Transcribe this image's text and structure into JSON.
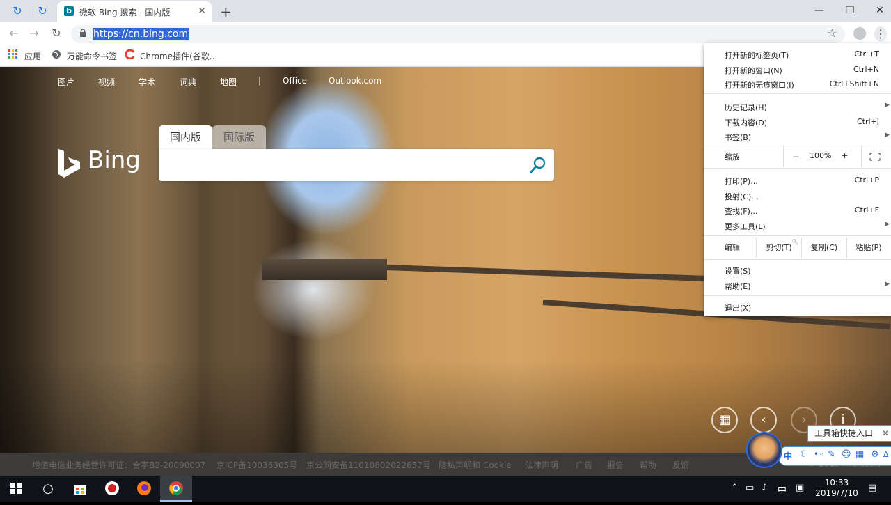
{
  "browser": {
    "tab": {
      "favicon": "b",
      "title": "微软 Bing 搜索 - 国内版",
      "close": "✕"
    },
    "new_tab": "+",
    "window": {
      "minimize": "—",
      "maximize": "❐",
      "close": "✕"
    },
    "address": {
      "url": "https://cn.bing.com"
    },
    "bookmarks": [
      {
        "label": "应用",
        "icon": "apps-grid-icon"
      },
      {
        "label": "万能命令书签",
        "icon": "globe-icon"
      },
      {
        "label": "Chrome插件(谷歌...",
        "icon": "chrome-c-icon"
      }
    ]
  },
  "page": {
    "nav_links": [
      "图片",
      "视频",
      "学术",
      "词典",
      "地图",
      "|",
      "Office",
      "Outlook.com"
    ],
    "logo_text": "Bing",
    "scope_tabs": [
      "国内版",
      "国际版"
    ],
    "footer_links": [
      "增值电信业务经营许可证：合字B2-20090007",
      "京ICP备10036305号",
      "京公网安备11010802022657号",
      "隐私声明和 Cookie",
      "法律声明",
      "广告",
      "报告",
      "帮助",
      "反馈",
      "© 2019 Microsoft"
    ]
  },
  "chrome_menu": {
    "new_tab": {
      "label": "打开新的标签页(T)",
      "shortcut": "Ctrl+T"
    },
    "new_window": {
      "label": "打开新的窗口(N)",
      "shortcut": "Ctrl+N"
    },
    "incognito": {
      "label": "打开新的无痕窗口(I)",
      "shortcut": "Ctrl+Shift+N"
    },
    "history": {
      "label": "历史记录(H)"
    },
    "downloads": {
      "label": "下载内容(D)",
      "shortcut": "Ctrl+J"
    },
    "bookmarks": {
      "label": "书签(B)"
    },
    "zoom": {
      "label": "缩放",
      "minus": "－",
      "value": "100%",
      "plus": "+"
    },
    "print": {
      "label": "打印(P)...",
      "shortcut": "Ctrl+P"
    },
    "cast": {
      "label": "投射(C)..."
    },
    "find": {
      "label": "查找(F)...",
      "shortcut": "Ctrl+F"
    },
    "more_tools": {
      "label": "更多工具(L)"
    },
    "edit": {
      "label": "编辑",
      "cut": "剪切(T)",
      "copy": "复制(C)",
      "paste": "粘贴(P)"
    },
    "settings": {
      "label": "设置(S)"
    },
    "help": {
      "label": "帮助(E)"
    },
    "exit": {
      "label": "退出(X)"
    }
  },
  "ime": {
    "label": "工具箱快捷入口",
    "close": "✕",
    "mode": "中",
    "icons": [
      "moon-icon",
      "quote-icon",
      "wrench-icon",
      "smiley-icon",
      "grid-icon",
      "lock-icon"
    ]
  },
  "taskbar": {
    "time": "10:33",
    "date": "2019/7/10",
    "tray_lang": "中"
  },
  "colors": {
    "accent": "#1a73e8",
    "url_highlight": "#3367d6",
    "bing_teal": "#00809d"
  }
}
